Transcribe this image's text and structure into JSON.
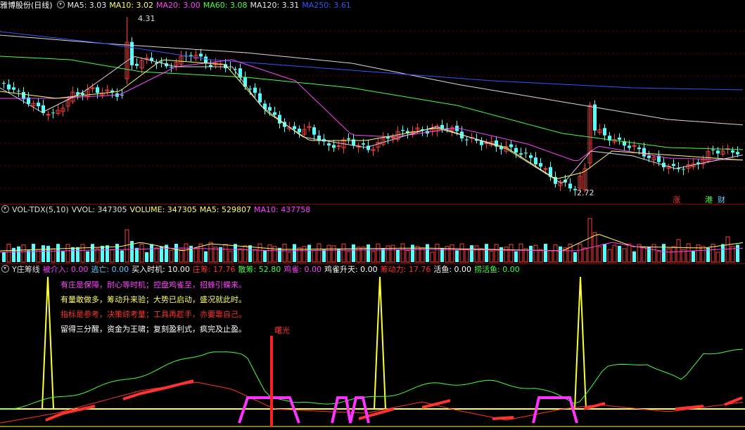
{
  "main": {
    "title": "雅博股份(日线)",
    "indicators": [
      {
        "label": "MA5: 3.03",
        "color": "#e8e8e8"
      },
      {
        "label": "MA10: 3.02",
        "color": "#ffff66"
      },
      {
        "label": "MA20: 3.00",
        "color": "#ff44ff"
      },
      {
        "label": "MA60: 3.08",
        "color": "#44ff44"
      },
      {
        "label": "MA120: 3.31",
        "color": "#e8e8e8"
      },
      {
        "label": "MA250: 3.61",
        "color": "#3355ff"
      }
    ],
    "high_label": "4.31",
    "low_label": "2.72",
    "badges": [
      {
        "text": "涨",
        "color": "#ff3333",
        "bg": "#1a0000"
      },
      {
        "text": "港",
        "color": "#44ff44",
        "bg": "#001a00"
      },
      {
        "text": "财",
        "color": "#66ccff",
        "bg": "#000a30"
      }
    ]
  },
  "volume": {
    "indicators": [
      {
        "label": "VOL-TDX(5,10)",
        "color": "#e0e0e0"
      },
      {
        "label": "VVOL: 347305",
        "color": "#e0e0e0"
      },
      {
        "label": "VOLUME: 347305",
        "color": "#ffff66"
      },
      {
        "label": "MA5: 529807",
        "color": "#ffff66"
      },
      {
        "label": "MA10: 437758",
        "color": "#ff44ff"
      }
    ]
  },
  "zhuang": {
    "indicators": [
      {
        "label": "Y庄筹线",
        "color": "#e0e0e0"
      },
      {
        "label": "被介入: 0.00",
        "color": "#ff44ff"
      },
      {
        "label": "逃亡: 0.00",
        "color": "#66ccff"
      },
      {
        "label": "买入时机: 10.00",
        "color": "#ffffff"
      },
      {
        "label": "庄筹: 17.76",
        "color": "#ff3333"
      },
      {
        "label": "散筹: 52.80",
        "color": "#44ff44"
      },
      {
        "label": "鸡雀: 0.00",
        "color": "#ff44ff"
      },
      {
        "label": "鸡雀升天: 0.00",
        "color": "#ffffff"
      },
      {
        "label": "筹动力: 17.76",
        "color": "#ff3333"
      },
      {
        "label": "活鱼: 0.00",
        "color": "#ffffff"
      },
      {
        "label": "捞活鱼: 0.00",
        "color": "#44ff44"
      }
    ],
    "notes": [
      {
        "text": "有庄是保障，耐心等时机；控盘鸡雀至，招蜂引蝶来。",
        "color": "#ff44ff"
      },
      {
        "text": "有量敢做多，筹动升来验；大势已启动，盛况就此时。",
        "color": "#ffff66"
      },
      {
        "text": "指标是参考，决策综考量；工具再趁手，亦要靠自己。",
        "color": "#ff3333"
      },
      {
        "text": "留得三分醒，资金为王啸；复刻盈利式，疯完及止盈。",
        "color": "#ffffff"
      }
    ],
    "signal_label": "曙光"
  }
}
